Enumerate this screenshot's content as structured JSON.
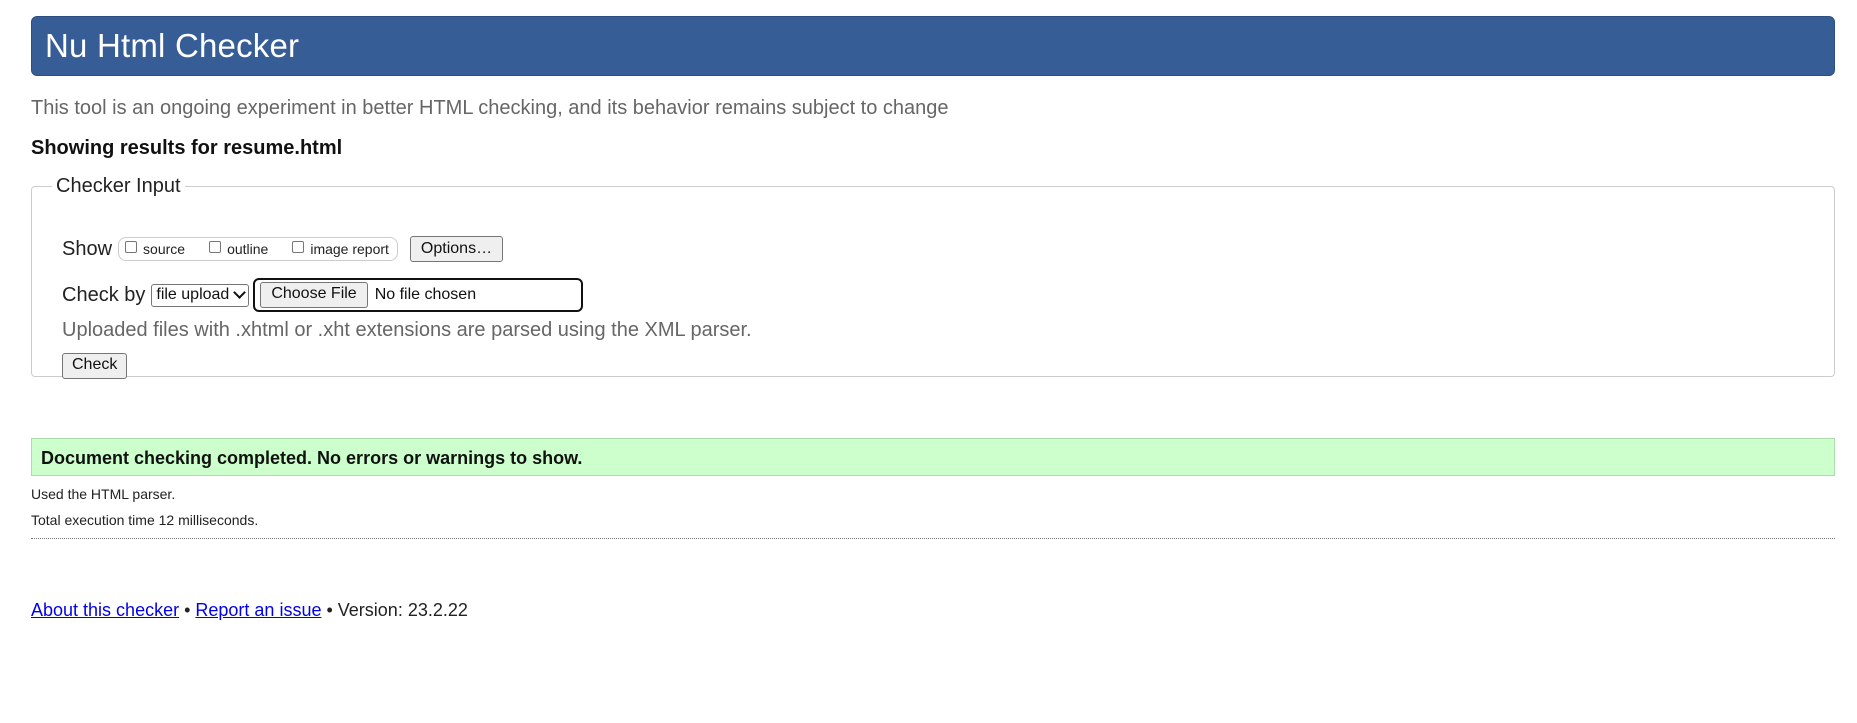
{
  "header": {
    "title": "Nu Html Checker"
  },
  "subtitle": "This tool is an ongoing experiment in better HTML checking, and its behavior remains subject to change",
  "results_for": {
    "label": "Showing results for",
    "filename": "resume.html"
  },
  "checker_input": {
    "legend": "Checker Input",
    "show_label": "Show",
    "show_options": [
      {
        "label": "source",
        "checked": false
      },
      {
        "label": "outline",
        "checked": false
      },
      {
        "label": "image report",
        "checked": false
      }
    ],
    "options_button": "Options…",
    "check_by_label": "Check by",
    "check_by_selected": "file upload",
    "choose_file_button": "Choose File",
    "file_status": "No file chosen",
    "upload_note": "Uploaded files with .xhtml or .xht extensions are parsed using the XML parser.",
    "check_button": "Check"
  },
  "result": {
    "message": "Document checking completed. No errors or warnings to show.",
    "parser_note": "Used the HTML parser.",
    "execution_time": "Total execution time 12 milliseconds."
  },
  "footer": {
    "about_link": "About this checker",
    "separator": "•",
    "report_link": "Report an issue",
    "version": "Version: 23.2.22"
  },
  "colors": {
    "header_bg": "#365d95",
    "success_bg": "#ccffcc",
    "link": "#0000ee",
    "muted_text": "#666666"
  }
}
